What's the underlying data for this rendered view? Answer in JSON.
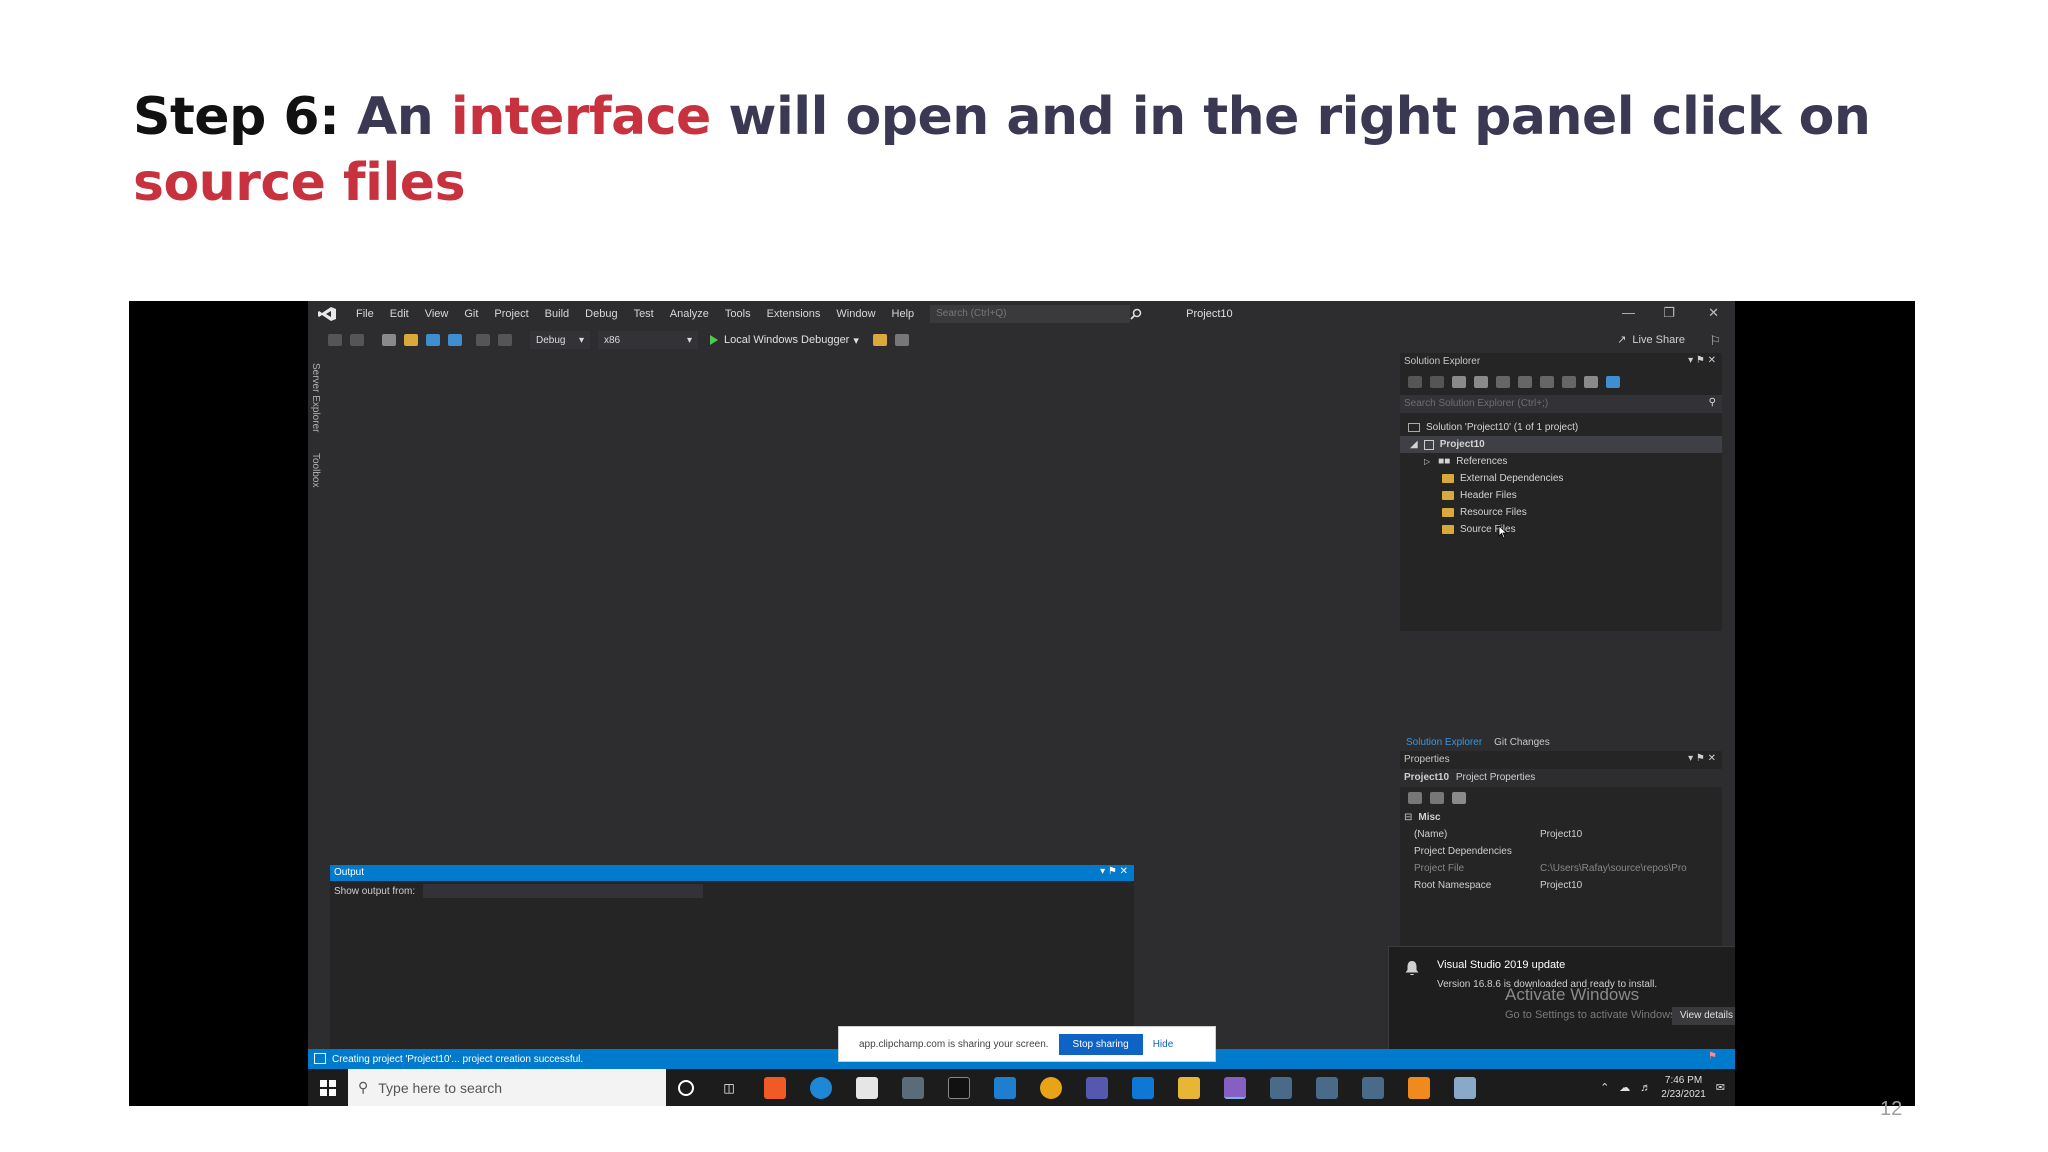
{
  "slide": {
    "title_lead": "Step 6:",
    "title_part1": " An ",
    "title_hl1": "interface",
    "title_part2": " will open and in the right panel click on ",
    "title_hl2": "source files",
    "page_number": "12"
  },
  "colors": {
    "accent": "#c8313e",
    "vs_blue": "#007acc",
    "vs_bg": "#2d2d30"
  },
  "menubar": {
    "items": [
      "File",
      "Edit",
      "View",
      "Git",
      "Project",
      "Build",
      "Debug",
      "Test",
      "Analyze",
      "Tools",
      "Extensions",
      "Window",
      "Help"
    ],
    "search_placeholder": "Search (Ctrl+Q)",
    "project_name": "Project10"
  },
  "toolbar": {
    "config": "Debug",
    "platform": "x86",
    "run_label": "Local Windows Debugger",
    "live_share": "Live Share"
  },
  "left_strip": {
    "server_explorer": "Server Explorer",
    "toolbox": "Toolbox"
  },
  "output": {
    "title": "Output",
    "show_output_from": "Show output from:"
  },
  "solution_explorer": {
    "title": "Solution Explorer",
    "search_placeholder": "Search Solution Explorer (Ctrl+;)",
    "solution": "Solution 'Project10' (1 of 1 project)",
    "project": "Project10",
    "items": [
      "References",
      "External Dependencies",
      "Header Files",
      "Resource Files",
      "Source Files"
    ],
    "tabs": [
      "Solution Explorer",
      "Git Changes"
    ]
  },
  "properties": {
    "title": "Properties",
    "object_name": "Project10",
    "object_type": "Project Properties",
    "section": "Misc",
    "rows": [
      {
        "key": "(Name)",
        "value": "Project10"
      },
      {
        "key": "Project Dependencies",
        "value": ""
      },
      {
        "key": "Project File",
        "value": "C:\\Users\\Rafay\\source\\repos\\Pro"
      },
      {
        "key": "Root Namespace",
        "value": "Project10"
      }
    ]
  },
  "toast": {
    "title": "Visual Studio 2019 update",
    "body": "Version 16.8.6 is downloaded and ready to install.",
    "button": "View details",
    "activate_title": "Activate Windows",
    "activate_sub": "Go to Settings to activate Windows."
  },
  "statusbar": {
    "message": "Creating project 'Project10'... project creation successful."
  },
  "share_banner": {
    "text": "app.clipchamp.com is sharing your screen.",
    "stop": "Stop sharing",
    "hide": "Hide"
  },
  "taskbar": {
    "search_placeholder": "Type here to search",
    "time": "7:46 PM",
    "date": "2/23/2021"
  }
}
